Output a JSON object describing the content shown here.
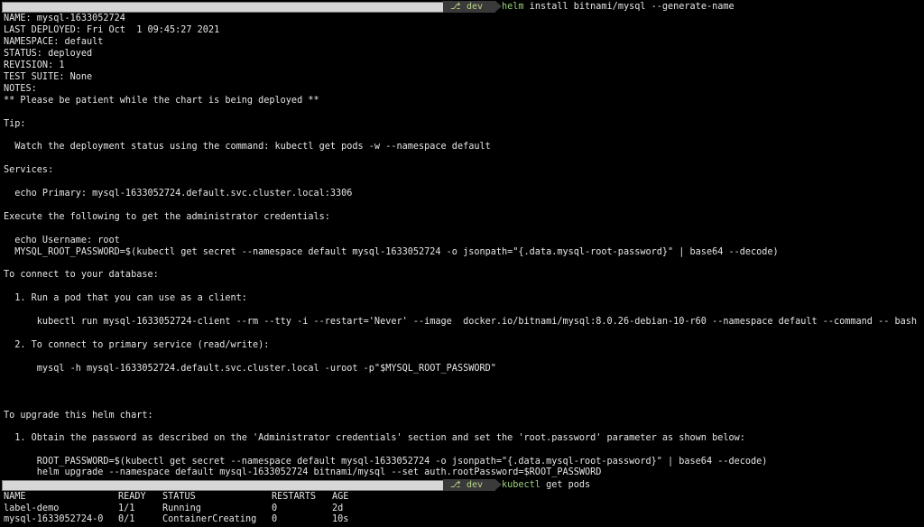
{
  "prompts": [
    {
      "branch_icon": "⎇",
      "branch": "dev",
      "bin": "helm",
      "args": " install bitnami/mysql --generate-name"
    },
    {
      "branch_icon": "⎇",
      "branch": "dev",
      "bin": "kubectl",
      "args": " get pods"
    }
  ],
  "output_lines": [
    "NAME: mysql-1633052724",
    "LAST DEPLOYED: Fri Oct  1 09:45:27 2021",
    "NAMESPACE: default",
    "STATUS: deployed",
    "REVISION: 1",
    "TEST SUITE: None",
    "NOTES:",
    "** Please be patient while the chart is being deployed **",
    "",
    "Tip:",
    "",
    "  Watch the deployment status using the command: kubectl get pods -w --namespace default",
    "",
    "Services:",
    "",
    "  echo Primary: mysql-1633052724.default.svc.cluster.local:3306",
    "",
    "Execute the following to get the administrator credentials:",
    "",
    "  echo Username: root",
    "  MYSQL_ROOT_PASSWORD=$(kubectl get secret --namespace default mysql-1633052724 -o jsonpath=\"{.data.mysql-root-password}\" | base64 --decode)",
    "",
    "To connect to your database:",
    "",
    "  1. Run a pod that you can use as a client:",
    "",
    "      kubectl run mysql-1633052724-client --rm --tty -i --restart='Never' --image  docker.io/bitnami/mysql:8.0.26-debian-10-r60 --namespace default --command -- bash",
    "",
    "  2. To connect to primary service (read/write):",
    "",
    "      mysql -h mysql-1633052724.default.svc.cluster.local -uroot -p\"$MYSQL_ROOT_PASSWORD\"",
    "",
    "",
    "",
    "To upgrade this helm chart:",
    "",
    "  1. Obtain the password as described on the 'Administrator credentials' section and set the 'root.password' parameter as shown below:",
    "",
    "      ROOT_PASSWORD=$(kubectl get secret --namespace default mysql-1633052724 -o jsonpath=\"{.data.mysql-root-password}\" | base64 --decode)",
    "      helm upgrade --namespace default mysql-1633052724 bitnami/mysql --set auth.rootPassword=$ROOT_PASSWORD"
  ],
  "pods_table": {
    "columns": [
      "NAME",
      "READY",
      "STATUS",
      "RESTARTS",
      "AGE"
    ],
    "rows": [
      [
        "label-demo",
        "1/1",
        "Running",
        "0",
        "2d"
      ],
      [
        "mysql-1633052724-0",
        "0/1",
        "ContainerCreating",
        "0",
        "10s"
      ]
    ]
  },
  "colors": {
    "background": "#000000",
    "text": "#e6e6e6",
    "command": "#9ad07a",
    "branch": "#b9d68a",
    "segment": "#3a3a3a"
  }
}
